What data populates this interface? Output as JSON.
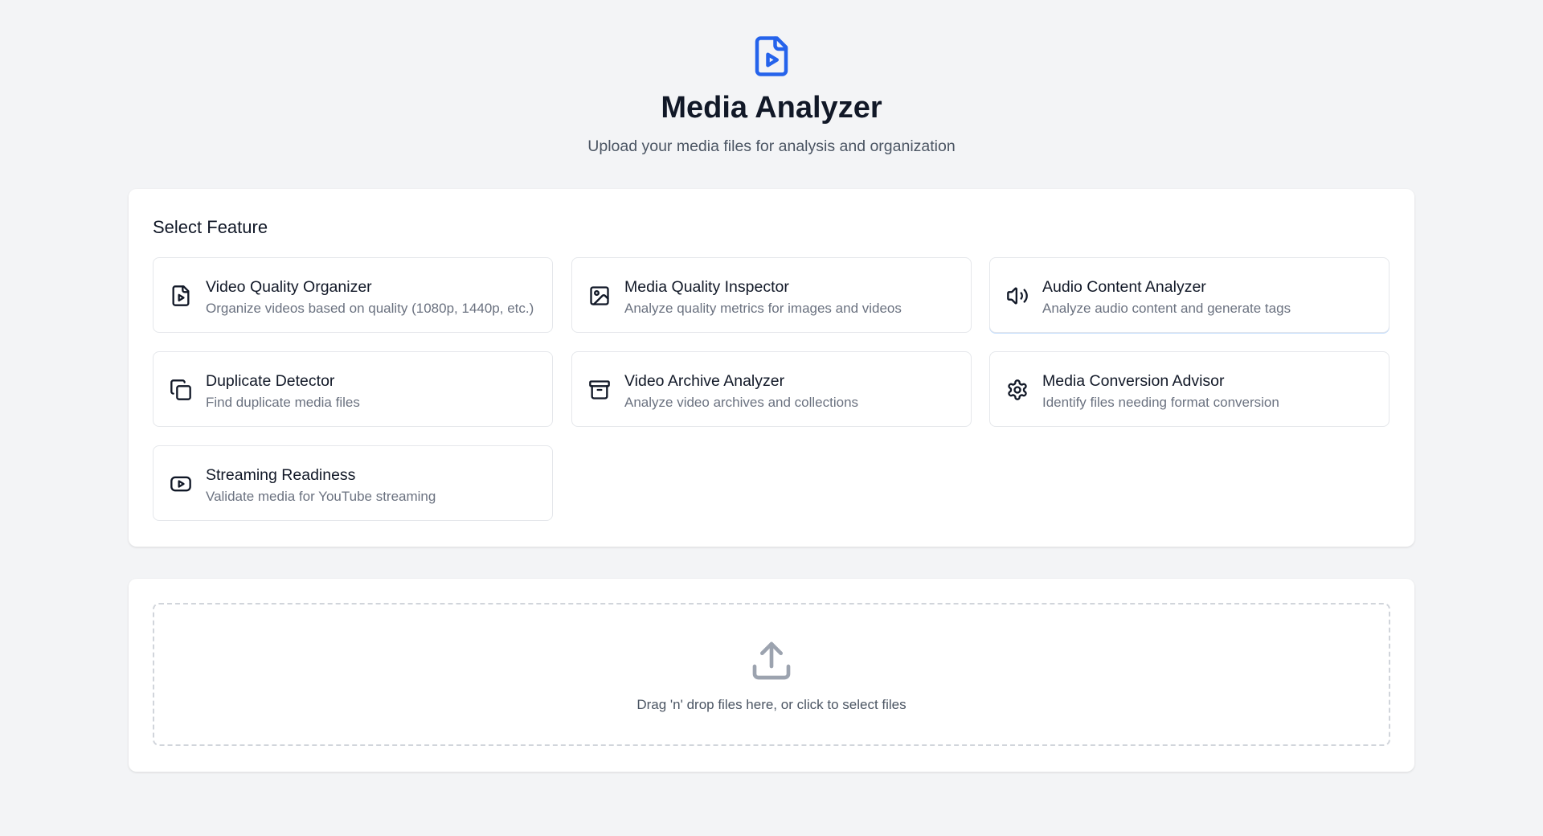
{
  "header": {
    "logo_icon": "file-video-icon",
    "title": "Media Analyzer",
    "subtitle": "Upload your media files for analysis and organization"
  },
  "features": {
    "section_title": "Select Feature",
    "items": [
      {
        "title": "Video Quality Organizer",
        "description": "Organize videos based on quality (1080p, 1440p, etc.)",
        "icon": "file-video-icon"
      },
      {
        "title": "Media Quality Inspector",
        "description": "Analyze quality metrics for images and videos",
        "icon": "image-icon"
      },
      {
        "title": "Audio Content Analyzer",
        "description": "Analyze audio content and generate tags",
        "icon": "volume-icon"
      },
      {
        "title": "Duplicate Detector",
        "description": "Find duplicate media files",
        "icon": "copy-icon"
      },
      {
        "title": "Video Archive Analyzer",
        "description": "Analyze video archives and collections",
        "icon": "archive-icon"
      },
      {
        "title": "Media Conversion Advisor",
        "description": "Identify files needing format conversion",
        "icon": "settings-gear-icon"
      },
      {
        "title": "Streaming Readiness",
        "description": "Validate media for YouTube streaming",
        "icon": "youtube-icon"
      }
    ]
  },
  "upload": {
    "icon": "upload-icon",
    "text": "Drag 'n' drop files here, or click to select files"
  },
  "colors": {
    "accent": "#2563eb",
    "background": "#f3f4f6",
    "muted_icon": "#9ca3af"
  }
}
